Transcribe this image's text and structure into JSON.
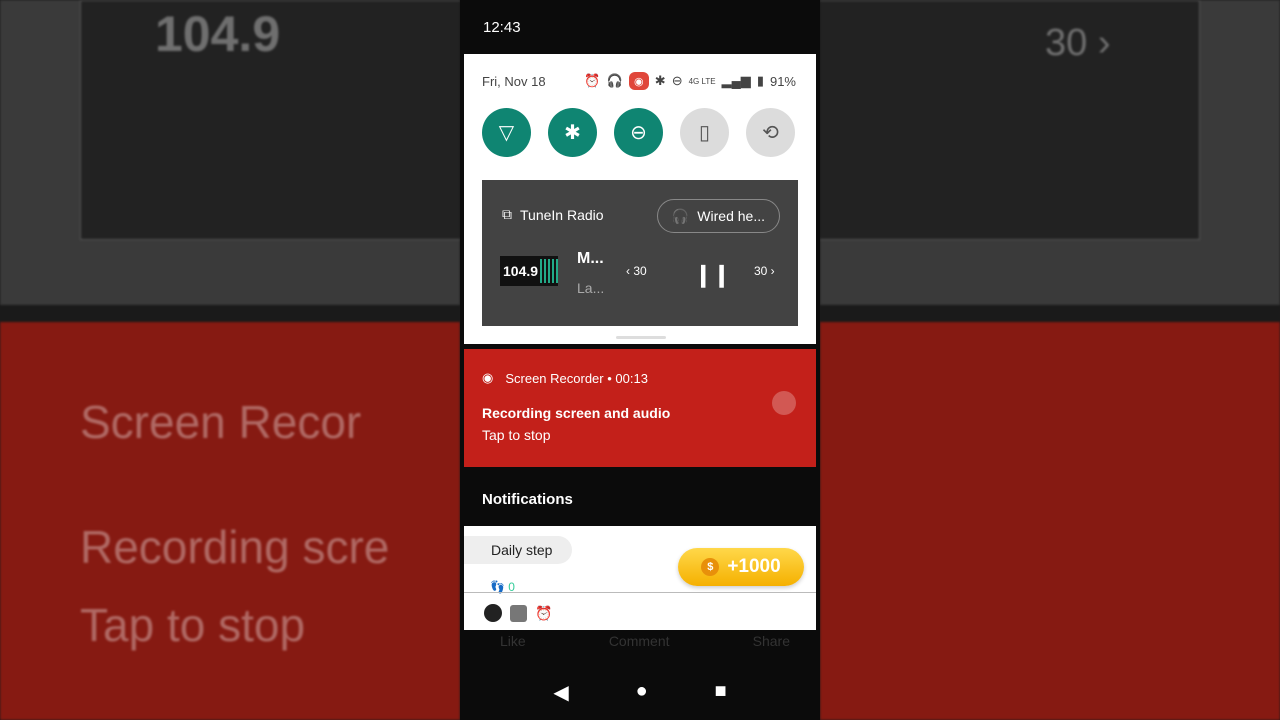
{
  "status_bar": {
    "time": "12:43"
  },
  "quick_settings": {
    "date": "Fri, Nov 18",
    "battery": "91%",
    "network": "4G LTE",
    "tiles": [
      {
        "name": "wifi",
        "on": true
      },
      {
        "name": "bluetooth",
        "on": true
      },
      {
        "name": "do-not-disturb",
        "on": true
      },
      {
        "name": "flashlight",
        "on": false
      },
      {
        "name": "auto-rotate",
        "on": false
      }
    ]
  },
  "media": {
    "app": "TuneIn Radio",
    "output": "Wired he...",
    "title": "M...",
    "subtitle": "La...",
    "art_text": "104.9",
    "rewind": "‹ 30",
    "forward": "30 ›"
  },
  "recorder": {
    "header": "Screen Recorder • 00:13",
    "title": "Recording screen and audio",
    "text": "Tap to stop"
  },
  "notifications": {
    "heading": "Notifications",
    "card": {
      "pill": "Daily step",
      "reward": "+1000",
      "steps": "0"
    }
  },
  "behind": {
    "like": "Like",
    "comment": "Comment",
    "share": "Share"
  },
  "background": {
    "big1": "Screen Recor",
    "big2": "Recording scre",
    "big3": "Tap to stop",
    "big4": "30 ›",
    "art": "104.9"
  }
}
